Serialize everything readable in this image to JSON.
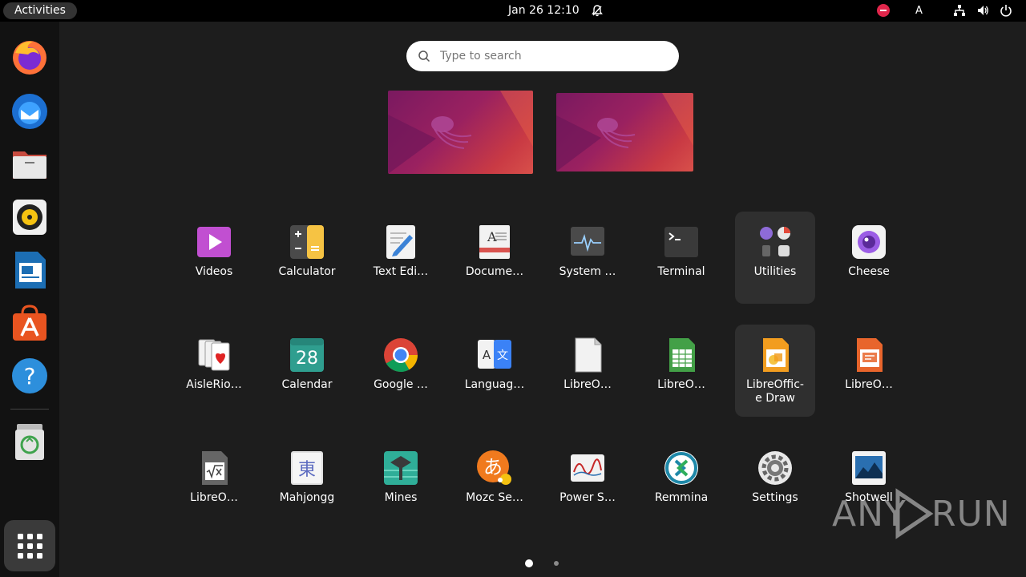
{
  "topbar": {
    "activities_label": "Activities",
    "clock": "Jan 26  12:10",
    "input_method": "A"
  },
  "dock": {
    "apps": [
      {
        "name": "Firefox",
        "icon": "firefox-icon"
      },
      {
        "name": "Thunderbird",
        "icon": "thunderbird-icon"
      },
      {
        "name": "Files",
        "icon": "files-icon"
      },
      {
        "name": "Rhythmbox",
        "icon": "rhythmbox-icon"
      },
      {
        "name": "LibreOffice Writer",
        "icon": "writer-icon"
      },
      {
        "name": "Ubuntu Software",
        "icon": "software-icon"
      },
      {
        "name": "Help",
        "icon": "help-icon"
      },
      {
        "name": "Trash",
        "icon": "trash-icon"
      }
    ],
    "show_apps_icon": "grid-icon"
  },
  "search": {
    "placeholder": "Type to search",
    "value": ""
  },
  "workspaces": [
    "Workspace 1",
    "Workspace 2"
  ],
  "app_grid": {
    "rows": [
      [
        {
          "label": "Videos",
          "icon": "videos-icon",
          "color": "#c14fd1"
        },
        {
          "label": "Calculator",
          "icon": "calculator-icon",
          "color": "#f6c343"
        },
        {
          "label": "Text Edi…",
          "icon": "text-editor-icon",
          "color": "#3b82d6"
        },
        {
          "label": "Docume…",
          "icon": "document-viewer-icon",
          "color": "#d9534f"
        },
        {
          "label": "System …",
          "icon": "system-monitor-icon",
          "color": "#4a4a4a"
        },
        {
          "label": "Terminal",
          "icon": "terminal-icon",
          "color": "#2c2c2c"
        },
        {
          "label": "Utilities",
          "icon": "utilities-folder-icon",
          "color": "#3a3a3a"
        },
        {
          "label": "Cheese",
          "icon": "cheese-icon",
          "color": "#9b5de5"
        }
      ],
      [
        {
          "label": "AisleRio…",
          "icon": "aisleriot-icon",
          "color": "#e02424"
        },
        {
          "label": "Calendar",
          "icon": "calendar-icon",
          "color": "#2f9e8f"
        },
        {
          "label": "Google …",
          "icon": "chrome-icon",
          "color": "#4285f4"
        },
        {
          "label": "Languag…",
          "icon": "language-icon",
          "color": "#3b82f6"
        },
        {
          "label": "LibreO…",
          "icon": "libreoffice-icon",
          "color": "#eeeeee"
        },
        {
          "label": "LibreO…",
          "icon": "libreoffice-calc-icon",
          "color": "#43a047"
        },
        {
          "label": "LibreOffic-e Draw",
          "icon": "libreoffice-draw-icon",
          "color": "#f29d1f"
        },
        {
          "label": "LibreO…",
          "icon": "libreoffice-impress-icon",
          "color": "#e8652c"
        }
      ],
      [
        {
          "label": "LibreO…",
          "icon": "libreoffice-math-icon",
          "color": "#666666"
        },
        {
          "label": "Mahjongg",
          "icon": "mahjongg-icon",
          "color": "#5c6bc0"
        },
        {
          "label": "Mines",
          "icon": "mines-icon",
          "color": "#2fae98"
        },
        {
          "label": "Mozc Se…",
          "icon": "mozc-icon",
          "color": "#f07a1e"
        },
        {
          "label": "Power S…",
          "icon": "power-statistics-icon",
          "color": "#c62828"
        },
        {
          "label": "Remmina",
          "icon": "remmina-icon",
          "color": "#1e88a8"
        },
        {
          "label": "Settings",
          "icon": "settings-icon",
          "color": "#777777"
        },
        {
          "label": "Shotwell",
          "icon": "shotwell-icon",
          "color": "#2a6fb0"
        }
      ]
    ]
  },
  "pagination": {
    "current": 1,
    "total": 2
  },
  "watermark": {
    "left": "ANY",
    "right": "RUN"
  }
}
